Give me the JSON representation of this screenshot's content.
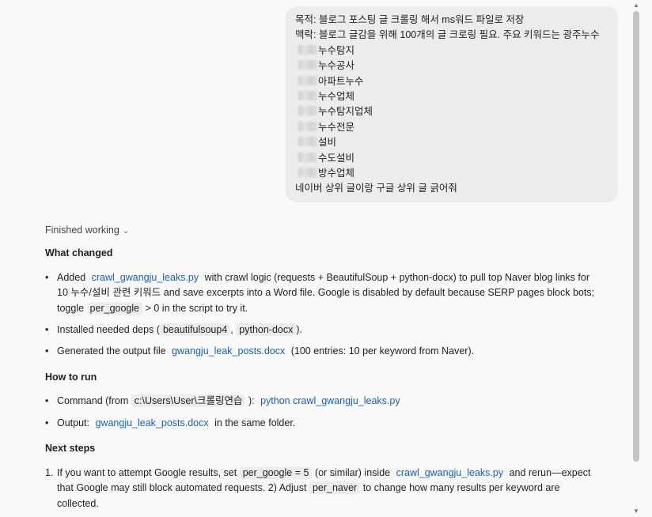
{
  "user_message": {
    "line1": "목적: 블로그 포스팅 글 크롤링 해서 ms워드 파일로 저장",
    "line2": "맥락: 블로그 글감을 위해 100개의 글 크로링 필요. 주요 키워드는 광주누수",
    "keywords": [
      "누수탐지",
      "누수공사",
      "아파트누수",
      "누수업체",
      "누수탐지업체",
      "누수전문",
      "설비",
      "수도설비",
      "방수업체"
    ],
    "last_line": "네이버 상위 글이랑 구글 상위 글 긁어줘"
  },
  "status": {
    "label": "Finished working",
    "chevron_icon": "chevron-down-icon"
  },
  "what_changed": {
    "heading": "What changed",
    "item1": {
      "pre": "Added",
      "link": "crawl_gwangju_leaks.py",
      "line1_rest": "with crawl logic (requests + BeautifulSoup + python-docx) to pull top Naver blog links for",
      "line2": "10 누수/설비 관련 키워드 and save excerpts into a Word file. Google is disabled by default because SERP pages block bots;",
      "line3_pre": "toggle",
      "line3_code": "per_google",
      "line3_post": "> 0 in the script to try it."
    },
    "item2": {
      "pre": "Installed needed deps (",
      "code1": "beautifulsoup4",
      "sep": ",",
      "code2": "python-docx",
      "post": ")."
    },
    "item3": {
      "pre": "Generated the output file",
      "link": "gwangju_leak_posts.docx",
      "post": "(100 entries: 10 per keyword from Naver)."
    }
  },
  "how_to_run": {
    "heading": "How to run",
    "item1": {
      "pre": "Command (from",
      "code": "c:\\Users\\User\\크롤링연습",
      "mid": "):",
      "link": "python crawl_gwangju_leaks.py"
    },
    "item2": {
      "pre": "Output:",
      "link": "gwangju_leak_posts.docx",
      "post": "in the same folder."
    }
  },
  "next_steps": {
    "heading": "Next steps",
    "number": "1.",
    "line1_pre": "If you want to attempt Google results, set",
    "line1_code": "per_google = 5",
    "line1_mid": "(or similar) inside",
    "line1_link": "crawl_gwangju_leaks.py",
    "line1_post": "and rerun—expect",
    "line2_pre": "that Google may still block automated requests. 2) Adjust",
    "line2_code": "per_naver",
    "line2_post": "to change how many results per keyword are",
    "line3": "collected."
  },
  "colors": {
    "link": "#1a5fb4",
    "bubble": "#ececec",
    "background": "#f9f9f9"
  }
}
